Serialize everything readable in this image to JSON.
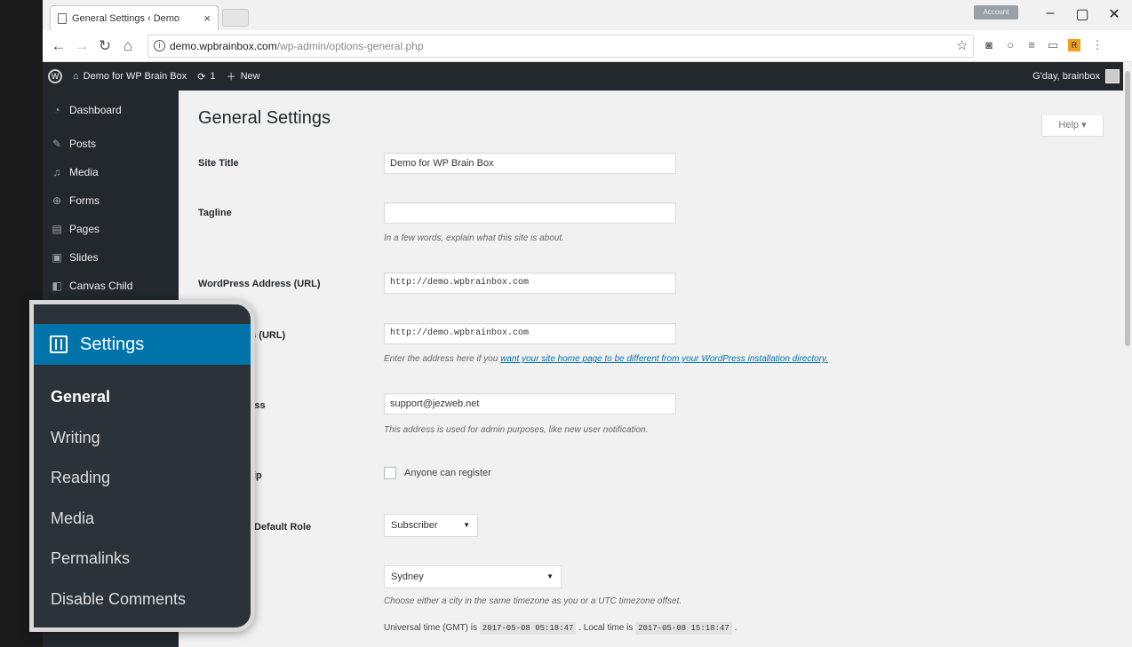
{
  "browser": {
    "tab_title": "General Settings ‹ Demo",
    "tab_close": "×",
    "profile": "Account",
    "address_host": "demo.wpbrainbox.com",
    "address_path": "/wp-admin/options-general.php"
  },
  "adminbar": {
    "site_name": "Demo for WP Brain Box",
    "updates_count": "1",
    "new_label": "New",
    "greeting": "G'day, brainbox"
  },
  "sidebar": {
    "items": [
      {
        "label": "Dashboard",
        "icon": "dashboard-icon"
      },
      {
        "label": "Posts",
        "icon": "pin-icon"
      },
      {
        "label": "Media",
        "icon": "media-icon"
      },
      {
        "label": "Forms",
        "icon": "forms-icon"
      },
      {
        "label": "Pages",
        "icon": "pages-icon"
      },
      {
        "label": "Slides",
        "icon": "slides-icon"
      },
      {
        "label": "Canvas Child",
        "icon": "canvas-icon"
      }
    ]
  },
  "main": {
    "title": "General Settings",
    "help_label": "Help ▾",
    "site_title_label": "Site Title",
    "site_title_value": "Demo for WP Brain Box",
    "tagline_label": "Tagline",
    "tagline_value": "",
    "tagline_desc": "In a few words, explain what this site is about.",
    "wp_address_label": "WordPress Address (URL)",
    "wp_address_value": "http://demo.wpbrainbox.com",
    "site_address_label": "ss (URL)",
    "site_address_value": "http://demo.wpbrainbox.com",
    "site_address_desc_pre": "Enter the address here if you ",
    "site_address_desc_link": "want your site home page to be different from your WordPress installation directory.",
    "email_label": "ress",
    "email_value": "support@jezweb.net",
    "email_desc": "This address is used for admin purposes, like new user notification.",
    "membership_label": "ip",
    "membership_checkbox": "Anyone can register",
    "role_label": "Default Role",
    "role_value": "Subscriber",
    "timezone_value": "Sydney",
    "timezone_desc": "Choose either a city in the same timezone as you or a UTC timezone offset.",
    "utc_label": "Universal time (GMT) is",
    "utc_value": "2017-05-08 05:18:47",
    "local_label": ". Local time is",
    "local_value": "2017-05-08 15:18:47",
    "time_end": "."
  },
  "callout": {
    "header": "Settings",
    "items": [
      "General",
      "Writing",
      "Reading",
      "Media",
      "Permalinks",
      "Disable Comments"
    ]
  },
  "colors": {
    "admin_dark": "#23282d",
    "accent_blue": "#0073aa",
    "content_bg": "#f1f1f1"
  }
}
